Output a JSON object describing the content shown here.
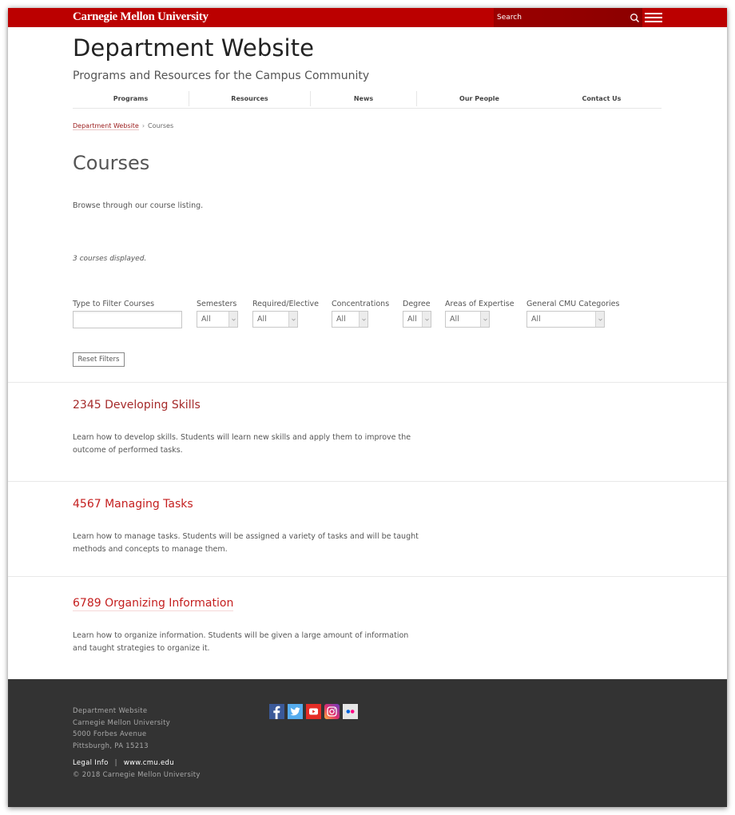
{
  "topbar": {
    "logo": "Carnegie Mellon University",
    "search_placeholder": "Search",
    "search_icon": "search-icon",
    "menu_icon": "hamburger-menu-icon",
    "brand_color": "#bb0000"
  },
  "header": {
    "title": "Department Website",
    "subtitle": "Programs and Resources for the Campus Community"
  },
  "nav": {
    "items": [
      {
        "label": "Programs"
      },
      {
        "label": "Resources"
      },
      {
        "label": "News"
      },
      {
        "label": "Our People"
      },
      {
        "label": "Contact Us"
      }
    ]
  },
  "breadcrumb": {
    "home": "Department Website",
    "separator": "›",
    "current": "Courses"
  },
  "page": {
    "title": "Courses",
    "intro": "Browse through our course listing.",
    "count_text": "3 courses displayed."
  },
  "filters": {
    "text_filter": {
      "label": "Type to Filter Courses",
      "value": ""
    },
    "selects": [
      {
        "label": "Semesters",
        "value": "All"
      },
      {
        "label": "Required/Elective",
        "value": "All"
      },
      {
        "label": "Concentrations",
        "value": "All"
      },
      {
        "label": "Degree",
        "value": "All"
      },
      {
        "label": "Areas of Expertise",
        "value": "All"
      },
      {
        "label": "General CMU Categories",
        "value": "All"
      }
    ],
    "reset_label": "Reset Filters"
  },
  "courses": [
    {
      "title": "2345 Developing Skills",
      "description": "Learn how to develop skills. Students will learn new skills and apply them to improve the outcome of performed tasks."
    },
    {
      "title": "4567 Managing Tasks",
      "description": "Learn how to manage tasks. Students will be assigned a variety of tasks and will be taught methods and concepts to manage them."
    },
    {
      "title": "6789 Organizing Information",
      "description": "Learn how to organize information. Students will be given a large amount of information and taught strategies to organize it."
    }
  ],
  "footer": {
    "address": [
      "Department Website",
      "Carnegie Mellon University",
      "5000 Forbes Avenue",
      "Pittsburgh, PA 15213"
    ],
    "links": [
      {
        "label": "Legal Info"
      },
      {
        "label": "www.cmu.edu"
      }
    ],
    "link_separator": "|",
    "copyright": "© 2018 Carnegie Mellon University",
    "social": [
      {
        "name": "facebook",
        "color": "#3b5998"
      },
      {
        "name": "twitter",
        "color": "#55acee"
      },
      {
        "name": "youtube",
        "color": "#e52d27"
      },
      {
        "name": "instagram",
        "color": "#c13584"
      },
      {
        "name": "flickr",
        "color": "#e6e6e6"
      }
    ]
  }
}
